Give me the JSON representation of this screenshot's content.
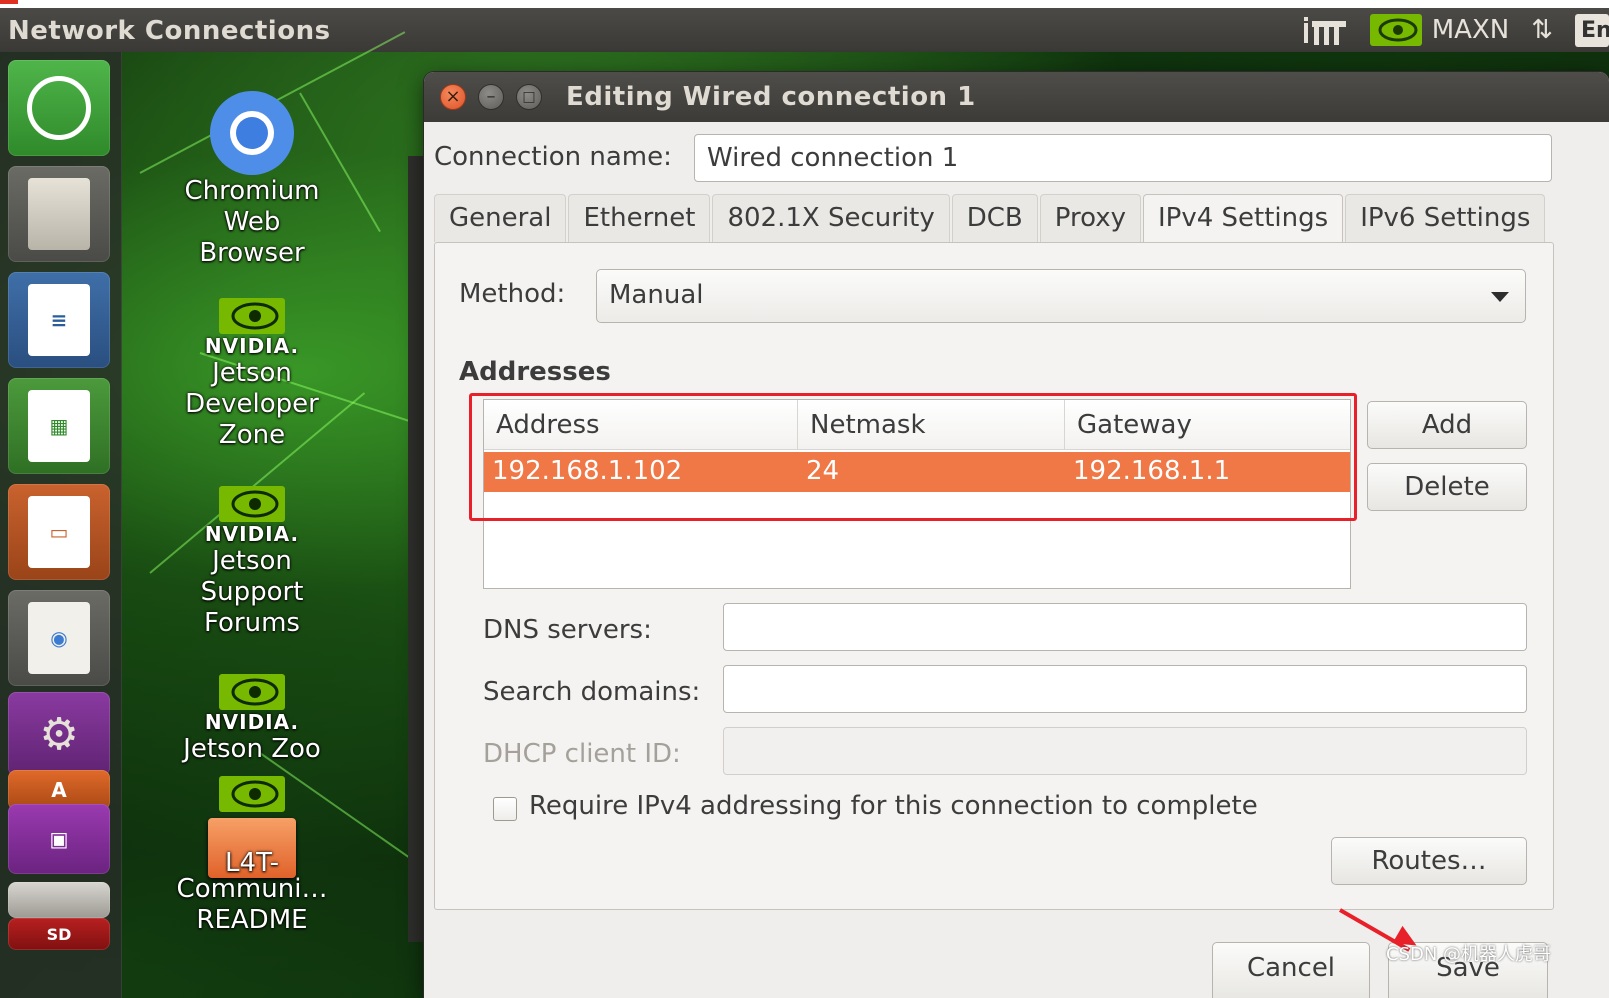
{
  "panel": {
    "window_title": "Network Connections",
    "power_mode": "MAXN",
    "keyboard_layout": "En"
  },
  "launcher": {
    "items": [
      {
        "name": "dash-home"
      },
      {
        "name": "files"
      },
      {
        "name": "libreoffice-writer"
      },
      {
        "name": "libreoffice-calc"
      },
      {
        "name": "libreoffice-impress"
      },
      {
        "name": "ubuntu-software"
      },
      {
        "name": "system-settings"
      },
      {
        "name": "software-updater"
      },
      {
        "name": "remote-desktop"
      },
      {
        "name": "drive"
      },
      {
        "name": "sd-card",
        "label": "SD"
      }
    ]
  },
  "desktop": {
    "icons": [
      {
        "label_lines": [
          "Chromium",
          "Web",
          "Browser"
        ]
      },
      {
        "brand": "NVIDIA.",
        "label_lines": [
          "Jetson",
          "Developer",
          "Zone"
        ]
      },
      {
        "brand": "NVIDIA.",
        "label_lines": [
          "Jetson",
          "Support",
          "Forums"
        ]
      },
      {
        "brand": "NVIDIA.",
        "label_lines": [
          "Jetson Zoo"
        ]
      },
      {
        "brand": "NVIDIA",
        "label_lines": [
          "Communi…",
          "README"
        ],
        "overlay": "L4T-"
      }
    ]
  },
  "dialog": {
    "title": "Editing Wired connection 1",
    "connection_name_label": "Connection name:",
    "connection_name_value": "Wired connection 1",
    "tabs": [
      {
        "label": "General"
      },
      {
        "label": "Ethernet"
      },
      {
        "label": "802.1X Security"
      },
      {
        "label": "DCB"
      },
      {
        "label": "Proxy"
      },
      {
        "label": "IPv4 Settings",
        "active": true
      },
      {
        "label": "IPv6 Settings"
      }
    ],
    "ipv4": {
      "method_label": "Method:",
      "method_value": "Manual",
      "addresses_title": "Addresses",
      "columns": [
        "Address",
        "Netmask",
        "Gateway"
      ],
      "rows": [
        {
          "address": "192.168.1.102",
          "netmask": "24",
          "gateway": "192.168.1.1",
          "selected": true
        }
      ],
      "add_label": "Add",
      "delete_label": "Delete",
      "dns_label": "DNS servers:",
      "dns_value": "",
      "search_label": "Search domains:",
      "search_value": "",
      "dhcp_label": "DHCP client ID:",
      "dhcp_value": "",
      "require_label": "Require IPv4 addressing for this connection to complete",
      "require_checked": false,
      "routes_label": "Routes…"
    },
    "cancel_label": "Cancel",
    "save_label": "Save"
  },
  "colors": {
    "selection": "#f07746",
    "annotation": "#e8202a",
    "panel": "#3c3b37"
  },
  "watermark": "CSDN @机器人虎哥"
}
